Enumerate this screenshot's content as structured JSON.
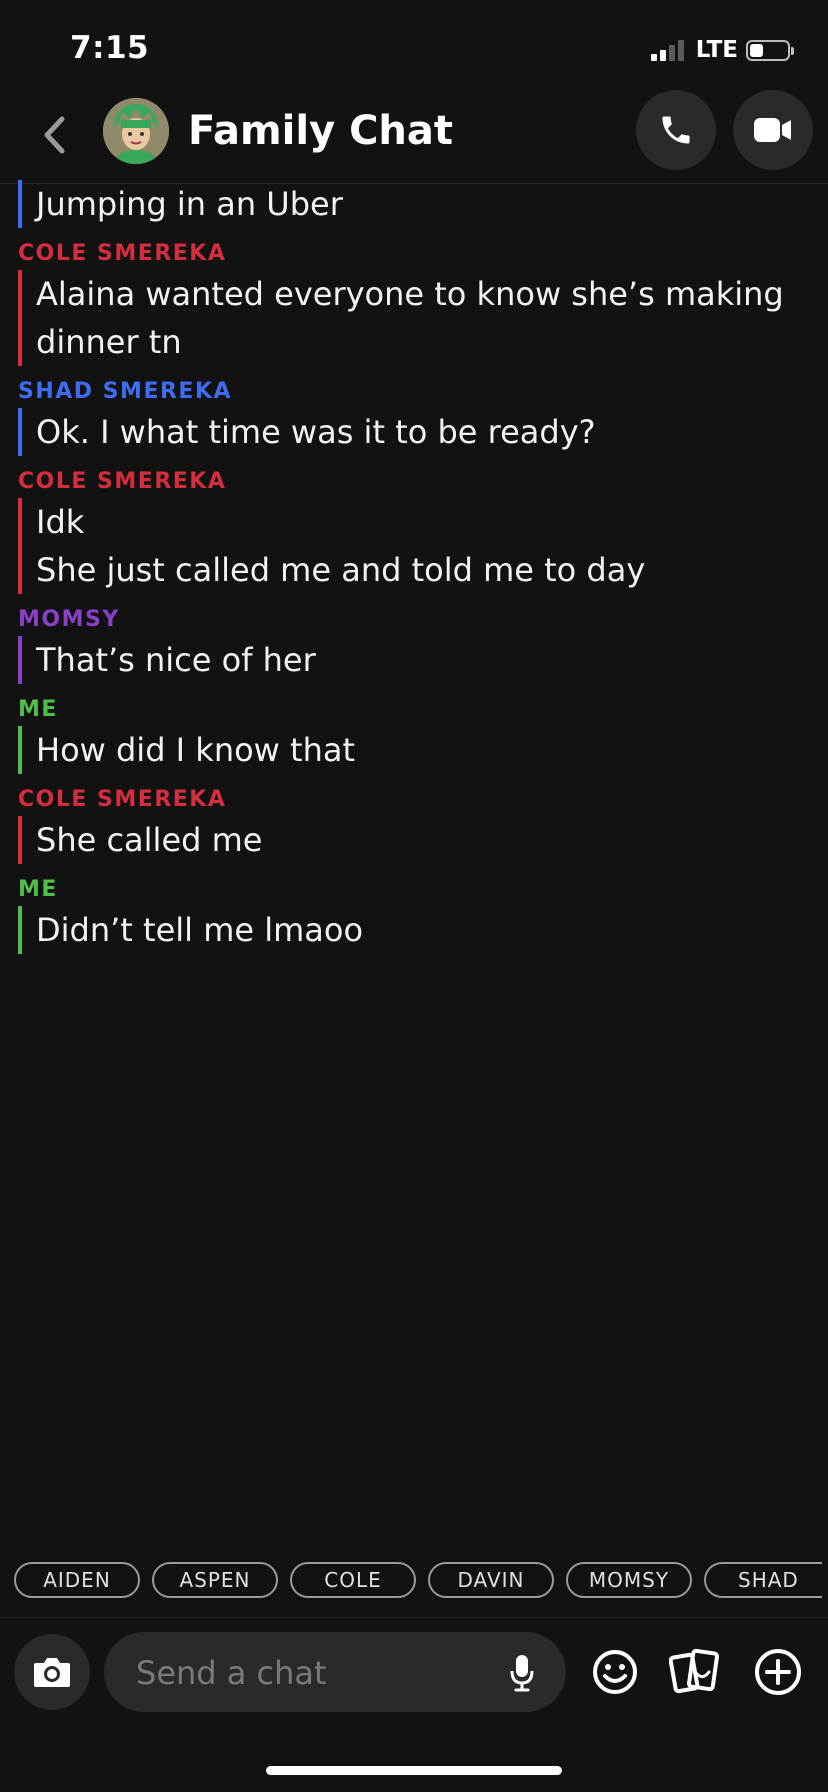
{
  "status_bar": {
    "time": "7:15",
    "network": "LTE",
    "signal_bars": 2,
    "battery_level": 0.35
  },
  "header": {
    "title": "Family Chat",
    "back_icon": "chevron-left-icon",
    "call_icon": "phone-icon",
    "video_icon": "video-camera-icon",
    "avatar_icon": "bitmoji-avatar"
  },
  "colors": {
    "background": "#121212",
    "cole": "#d42d3d",
    "shad": "#3d6cf0",
    "momsy": "#8a3fc9",
    "me": "#4fbf4a"
  },
  "messages": [
    {
      "sender": "",
      "color": "#3d6cf0",
      "lines": [
        "Jumping in an Uber"
      ]
    },
    {
      "sender": "COLE SMEREKA",
      "color": "#d42d3d",
      "lines": [
        "Alaina wanted everyone to know she’s making",
        "dinner tn"
      ]
    },
    {
      "sender": "SHAD SMEREKA",
      "color": "#3d6cf0",
      "lines": [
        "Ok.  I what time was it to be ready?"
      ]
    },
    {
      "sender": "COLE SMEREKA",
      "color": "#d42d3d",
      "lines": [
        "Idk",
        "She just called me and told me to day"
      ]
    },
    {
      "sender": "MOMSY",
      "color": "#8a3fc9",
      "lines": [
        "That’s nice of her"
      ]
    },
    {
      "sender": "ME",
      "color": "#4fbf4a",
      "lines": [
        "How did I know that"
      ]
    },
    {
      "sender": "COLE SMEREKA",
      "color": "#d42d3d",
      "lines": [
        "She called me"
      ]
    },
    {
      "sender": "ME",
      "color": "#4fbf4a",
      "lines": [
        "Didn’t tell me lmaoo"
      ]
    }
  ],
  "mention_chips": [
    "AIDEN",
    "ASPEN",
    "COLE",
    "DAVIN",
    "MOMSY",
    "SHAD"
  ],
  "input_bar": {
    "placeholder": "Send a chat",
    "camera_icon": "camera-icon",
    "mic_icon": "microphone-icon",
    "emoji_icon": "smiley-icon",
    "cards_icon": "cards-icon",
    "plus_icon": "plus-circle-icon"
  }
}
